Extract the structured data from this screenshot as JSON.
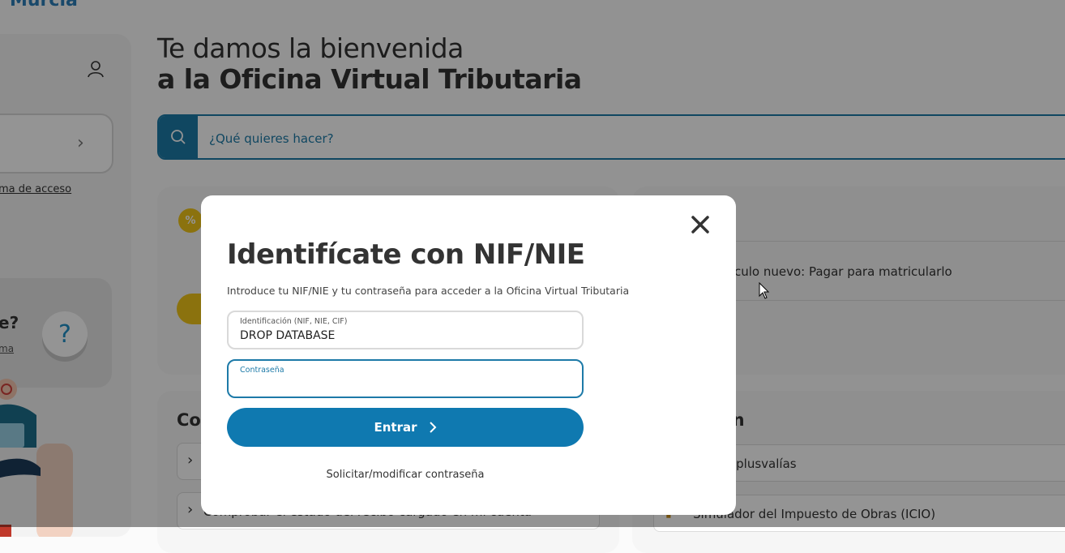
{
  "brand": "Murcia",
  "sidebar": {
    "access_link": "ma de acceso",
    "help_question": "e?",
    "help_link": "ma",
    "help_symbol": "?"
  },
  "main": {
    "welcome_line1": "Te damos la bienvenida",
    "welcome_line2": "a la Oficina Virtual Tributaria",
    "search_placeholder": "¿Qué quieres hacer?",
    "vehicle_item": "culo nuevo: Pagar para matricularlo",
    "section_left": "Co",
    "section_right": "ión",
    "row_left_2": "Comprobar el estado del recibo cargado en mi cuenta",
    "row_right_1": "dor de plusvalías",
    "row_right_2": "Simulador del Impuesto de Obras (ICIO)"
  },
  "modal": {
    "title": "Identifícate con NIF/NIE",
    "description": "Introduce tu NIF/NIE y tu contraseña para acceder a la Oficina Virtual Tributaria",
    "id_label": "Identificación (NIF, NIE, CIF)",
    "id_value": "DROP DATABASE",
    "password_label": "Contraseña",
    "password_value": "",
    "enter_label": "Entrar",
    "password_link": "Solicitar/modificar contraseña"
  },
  "colors": {
    "accent": "#0f79b0",
    "overlay": "rgba(0,0,0,0.42)",
    "yellow": "#f0c419"
  },
  "icons": [
    "user-icon",
    "search-icon",
    "close-icon",
    "chevron-right-icon",
    "help-icon",
    "coin-icon",
    "cursor-icon"
  ]
}
